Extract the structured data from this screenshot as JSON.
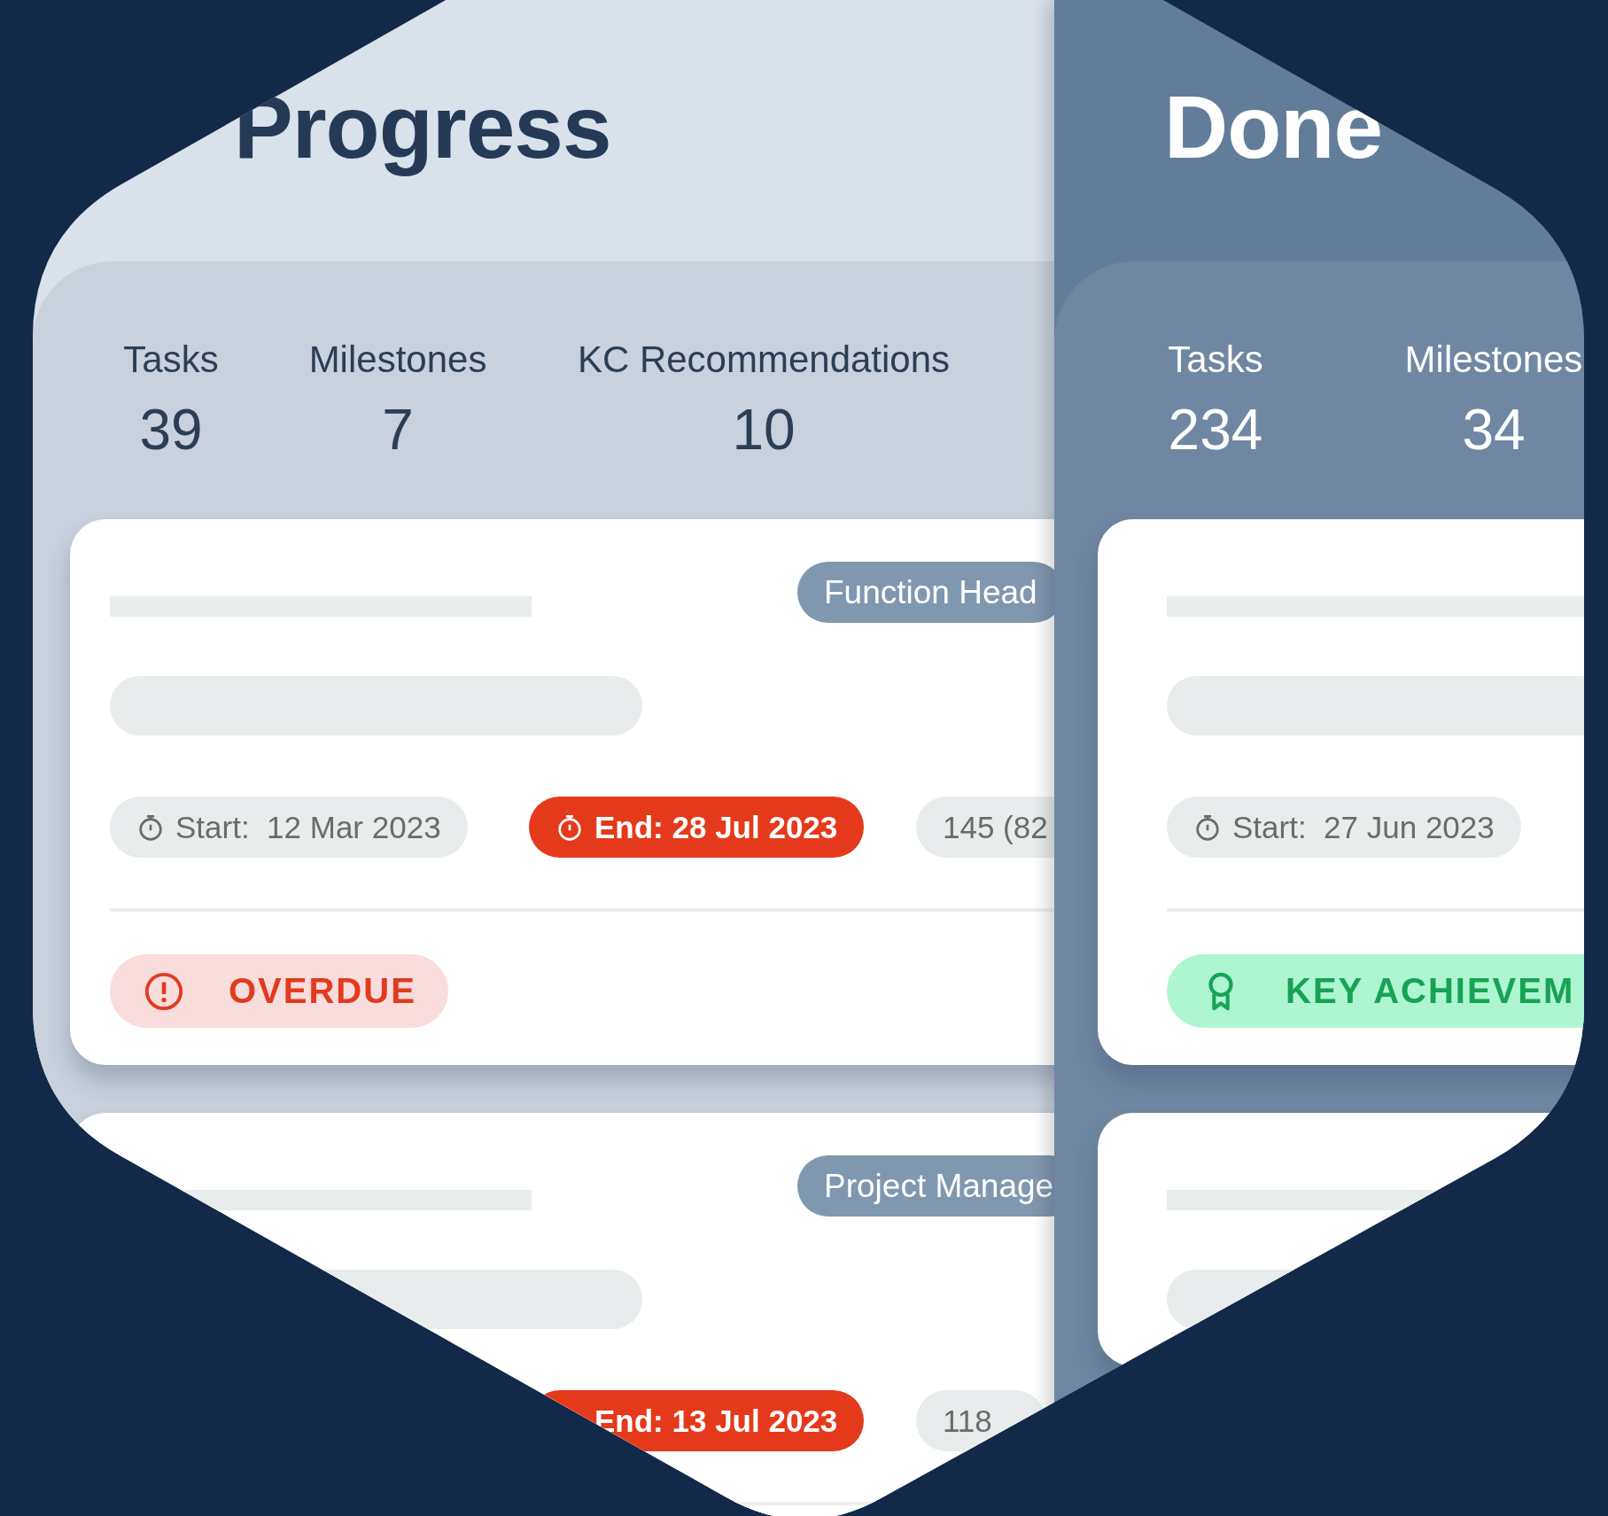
{
  "columns": [
    {
      "title": "Progress",
      "dark": false,
      "stats": [
        {
          "label": "Tasks",
          "value": "39"
        },
        {
          "label": "Milestones",
          "value": "7"
        },
        {
          "label": "KC Recommendations",
          "value": "10"
        }
      ],
      "cards": [
        {
          "kind": "task",
          "role": "Function Head",
          "pills": [
            {
              "kind": "start",
              "icon": true,
              "text": "Start:  12 Mar 2023"
            },
            {
              "kind": "end",
              "icon": true,
              "text": "End: 28 Jul 2023"
            },
            {
              "kind": "count",
              "icon": false,
              "text": "145 (82"
            }
          ],
          "status": {
            "kind": "overdue",
            "text": "OVERDUE"
          }
        },
        {
          "kind": "task",
          "role": "Project Manage",
          "pills": [
            {
              "kind": "end",
              "icon": false,
              "text": "End: 13 Jul 2023"
            },
            {
              "kind": "count",
              "icon": false,
              "text": "118"
            }
          ]
        }
      ]
    },
    {
      "title": "Done",
      "dark": true,
      "stats": [
        {
          "label": "Tasks",
          "value": "234"
        },
        {
          "label": "Milestones",
          "value": "34"
        }
      ],
      "cards": [
        {
          "kind": "task",
          "pills": [
            {
              "kind": "start",
              "icon": true,
              "text": "Start:  27 Jun 2023"
            }
          ],
          "status": {
            "kind": "achievement",
            "text": "KEY ACHIEVEM"
          }
        },
        {
          "kind": "task"
        }
      ]
    }
  ]
}
